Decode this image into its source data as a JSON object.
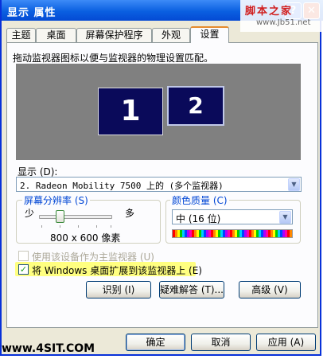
{
  "window": {
    "title": "显示 属性",
    "help_glyph": "?",
    "close_glyph": "✕"
  },
  "watermark": {
    "top_cn": "脚本之家",
    "top_url": "www.Jb51.net",
    "bottom": "www.4SIT.COM"
  },
  "tabs": [
    {
      "label": "主题",
      "active": false
    },
    {
      "label": "桌面",
      "active": false
    },
    {
      "label": "屏幕保护程序",
      "active": false
    },
    {
      "label": "外观",
      "active": false
    },
    {
      "label": "设置",
      "active": true
    }
  ],
  "settings": {
    "instruction": "拖动监视器图标以便与监视器的物理设置匹配。",
    "monitors": [
      {
        "number": "1",
        "selected": false
      },
      {
        "number": "2",
        "selected": true
      }
    ],
    "display_label": "显示 (D):",
    "display_value": "2. Radeon Mobility 7500 上的 (多个监视器)",
    "resolution": {
      "group_title": "屏幕分辨率 (S)",
      "less": "少",
      "more": "多",
      "value": "800 x 600 像素"
    },
    "color": {
      "group_title": "颜色质量 (C)",
      "value": "中 (16 位)"
    },
    "primary_checkbox": {
      "label": "使用该设备作为主监视器 (U)",
      "checked": false,
      "enabled": false
    },
    "extend_checkbox": {
      "label": "将 Windows 桌面扩展到该监视器上 (E)",
      "checked": true,
      "enabled": true
    },
    "check_glyph": "✓",
    "dropdown_glyph": "▼",
    "buttons": {
      "identify": "识别 (I)",
      "troubleshoot": "疑难解答 (T)...",
      "advanced": "高级 (V)"
    }
  },
  "footer": {
    "ok": "确定",
    "cancel": "取消",
    "apply": "应用 (A)"
  }
}
